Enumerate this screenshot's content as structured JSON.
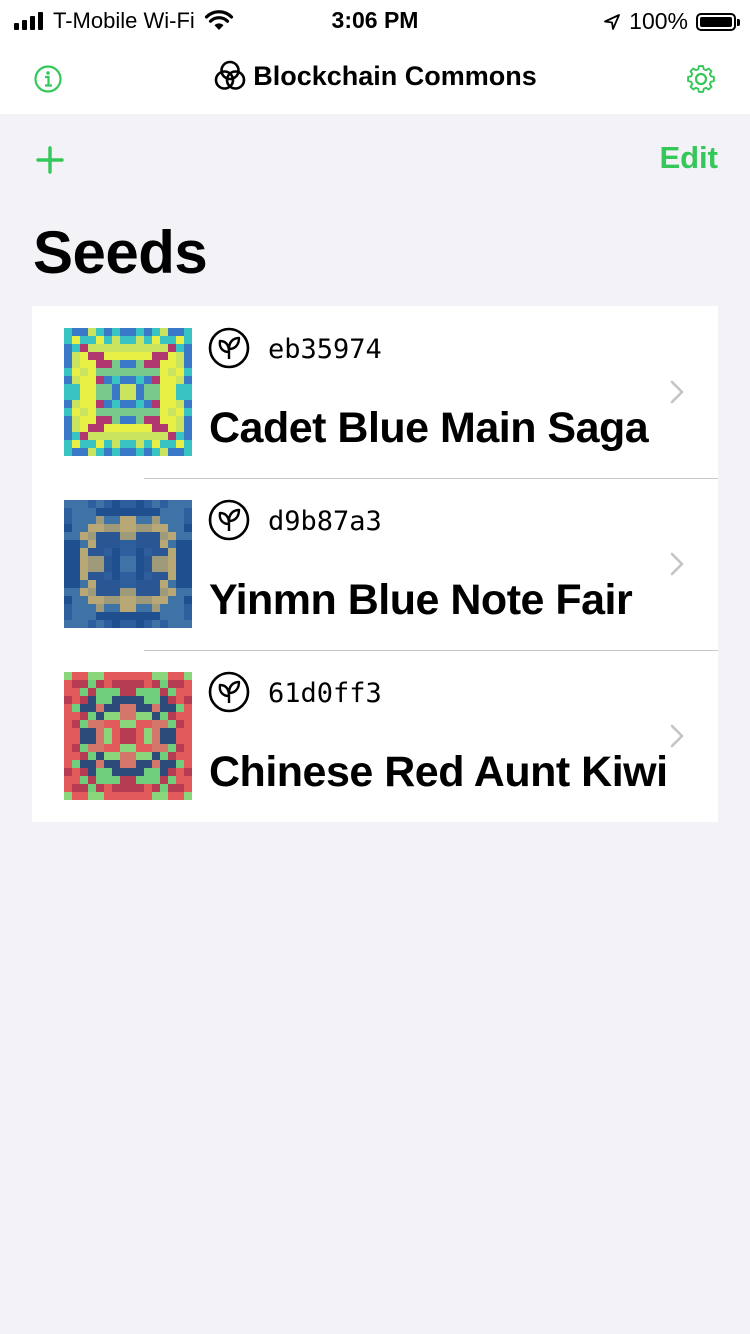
{
  "status_bar": {
    "carrier": "T-Mobile Wi-Fi",
    "time": "3:06 PM",
    "battery": "100%"
  },
  "nav": {
    "title": "Blockchain Commons",
    "icons": {
      "left": "info-icon",
      "right": "gear-icon",
      "logo": "blockchain-commons-logo"
    }
  },
  "toolbar": {
    "add_icon": "plus-icon",
    "edit_label": "Edit"
  },
  "page": {
    "title": "Seeds"
  },
  "seeds": [
    {
      "id": "eb35974",
      "name": "Cadet Blue Main Saga",
      "palette": [
        "#3a78c8",
        "#39c3c3",
        "#c9e35f",
        "#e8ef45",
        "#b0376f",
        "#79c98a"
      ]
    },
    {
      "id": "d9b87a3",
      "name": "Yinmn Blue Note Fair",
      "palette": [
        "#2e5f9c",
        "#1f4f8e",
        "#3f73a8",
        "#b8a875",
        "#9e9a7a",
        "#2a5694"
      ]
    },
    {
      "id": "61d0ff3",
      "name": "Chinese Red Aunt Kiwi",
      "palette": [
        "#8bd67a",
        "#e25a5a",
        "#b63c54",
        "#6fcf7c",
        "#2d4b7a",
        "#d4766a"
      ]
    }
  ],
  "colors": {
    "accent": "#34c759",
    "background": "#f2f2f7",
    "separator": "#c8c7cc"
  }
}
